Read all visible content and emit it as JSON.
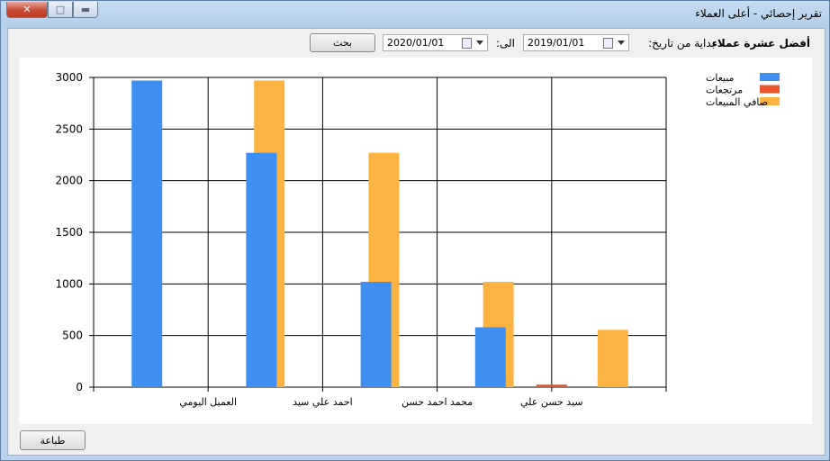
{
  "window": {
    "title": "تقرير إحصائي - أعلى العملاء",
    "close_glyph": "✕",
    "max_glyph": "□",
    "min_glyph": "▬"
  },
  "filters": {
    "heading": "أفضل عشرة عملاء",
    "from_label": "بداية من تاريخ:",
    "from_value": "2019/01/01",
    "to_label": "الى:",
    "to_value": "2020/01/01",
    "search_label": "بحث"
  },
  "print_label": "طباعة",
  "chart_data": {
    "type": "bar",
    "categories": [
      "العميل اليومي",
      "احمد علي سيد",
      "محمد احمد حسن",
      "سيد حسن علي"
    ],
    "series": [
      {
        "name": "مبيعات",
        "color": "#3f8ff0",
        "values": [
          2970,
          2270,
          1020,
          580
        ]
      },
      {
        "name": "مرتجعات",
        "color": "#e8552e",
        "values": [
          0,
          0,
          0,
          25
        ]
      },
      {
        "name": "صافي المبيعات",
        "color": "#fbb342",
        "values": [
          2970,
          2270,
          1020,
          555
        ]
      }
    ],
    "ylim": [
      0,
      3000
    ],
    "yticks": [
      0,
      500,
      1000,
      1500,
      2000,
      2500,
      3000
    ],
    "grid": true,
    "legend": "top-right"
  }
}
